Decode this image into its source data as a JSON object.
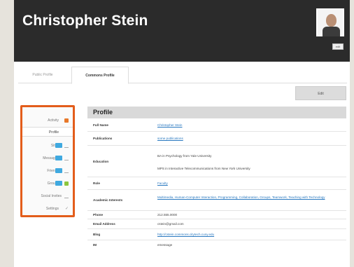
{
  "profile": {
    "name": "Christopher Stein",
    "edit_photo": "edit"
  },
  "tabs": [
    {
      "label": "Public Profile"
    },
    {
      "label": "Commons Profile"
    }
  ],
  "edit_button": "Edit",
  "sidebar": {
    "items": [
      {
        "label": "Activity",
        "icon": "activity-icon",
        "color": "#e8782a"
      },
      {
        "label": "Profile",
        "icon": "",
        "color": ""
      },
      {
        "label": "Sites",
        "icon": "sites-icon",
        "color": "#3fa9e0"
      },
      {
        "label": "Messages",
        "icon": "messages-icon",
        "color": "#3fa9e0"
      },
      {
        "label": "Friends",
        "icon": "friends-icon",
        "color": "#3fa9e0"
      },
      {
        "label": "Groups",
        "icon": "groups-icon",
        "color": "#3fa9e0"
      },
      {
        "label": "Social Invites",
        "icon": "invites-icon",
        "color": "#999999"
      },
      {
        "label": "Settings",
        "icon": "settings-icon",
        "color": "#999999"
      }
    ]
  },
  "section_title": "Profile",
  "fields": [
    {
      "key": "Full Name",
      "value": "Christopher Stein",
      "link": true
    },
    {
      "key": "Publications",
      "value": "some publications",
      "link": true
    },
    {
      "key": "Education",
      "value": "BA in Psychology from Yale University",
      "value2": "MPS in Interactive Telecommunications from New York University",
      "link": false
    },
    {
      "key": "Role",
      "value": "Faculty",
      "link": true
    },
    {
      "key": "Academic Interests",
      "value": "Multimedia, Human-Computer Interaction, Programming, Collaboration, Groups, Teamwork, Teaching with Technology",
      "link": true
    },
    {
      "key": "Phone",
      "value": "212.555.0000",
      "link": false
    },
    {
      "key": "Email Address",
      "value": "cstein@gmail.com",
      "link": false
    },
    {
      "key": "Blog",
      "value": "http://cstein.commons.citytech.cuny.edu",
      "link": true
    },
    {
      "key": "IM",
      "value": "emessage",
      "link": false
    }
  ]
}
